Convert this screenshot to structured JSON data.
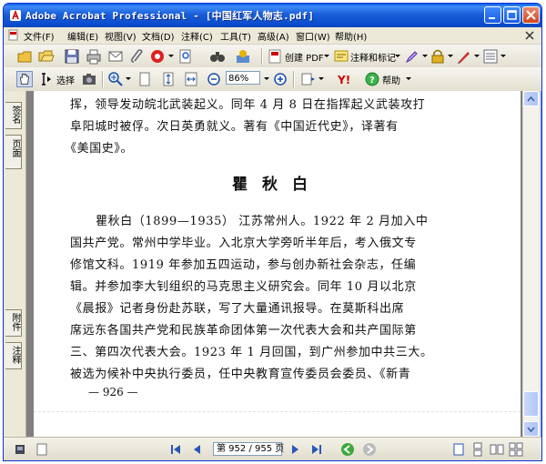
{
  "window": {
    "title": "Adobe Acrobat Professional - [中国红军人物志.pdf]"
  },
  "menu": {
    "items": [
      "文件(F)",
      "编辑(E)",
      "视图(V)",
      "文档(D)",
      "注释(C)",
      "工具(T)",
      "高级(A)",
      "窗口(W)",
      "帮助(H)"
    ]
  },
  "toolbar1": {
    "create_pdf_label": "创建 PDF",
    "comment_label": "注释和标记"
  },
  "toolbar2": {
    "select_label": "选择",
    "zoom_value": "86%",
    "help_label": "帮助"
  },
  "left_panel": {
    "tabs": [
      "签名",
      "页面",
      "附件",
      "注释"
    ]
  },
  "document": {
    "lines_top": [
      "挥，领导发动皖北武装起义。同年 4 月 8 日在指挥起义武装攻打",
      "阜阳城时被俘。次日英勇就义。著有《中国近代史》，译著有",
      "《美国史》。"
    ],
    "heading": "瞿秋白",
    "lines_body": [
      "瞿秋白（1899—1935）    江苏常州人。1922 年 2 月加入中",
      "国共产党。常州中学毕业。入北京大学旁听半年后，考入俄文专",
      "修馆文科。1919 年参加五四运动，参与创办新社会杂志，任编",
      "辑。并参加李大钊组织的马克思主义研究会。同年 10 月以北京",
      "《晨报》记者身份赴苏联，写了大量通讯报导。在莫斯科出席",
      "席远东各国共产党和民族革命团体第一次代表大会和共产国际第",
      "三、第四次代表大会。1923 年 1 月回国，到广州参加中共三大。",
      "被选为候补中央执行委员，任中央教育宣传委员会委员、《新青"
    ],
    "page_number": "— 926 —"
  },
  "statusbar": {
    "page_indicator": "第 952 / 955 页"
  }
}
